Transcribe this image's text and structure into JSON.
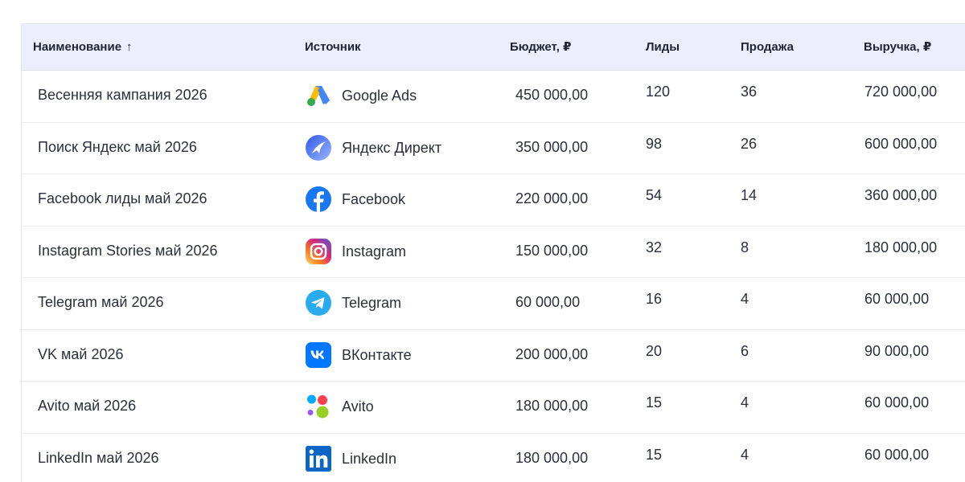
{
  "table": {
    "headers": {
      "name": "Наименование",
      "sort_indicator": "↑",
      "source": "Источник",
      "budget": "Бюджет, ₽",
      "leads": "Лиды",
      "sales": "Продажа",
      "revenue": "Выручка, ₽"
    },
    "rows": [
      {
        "name": "Весенняя кампания 2026",
        "source": "Google Ads",
        "icon": "google-ads-icon",
        "budget": "450 000,00",
        "leads": "120",
        "sales": "36",
        "revenue": "720 000,00"
      },
      {
        "name": "Поиск Яндекс май 2026",
        "source": "Яндекс Директ",
        "icon": "yandex-direct-icon",
        "budget": "350 000,00",
        "leads": "98",
        "sales": "26",
        "revenue": "600 000,00"
      },
      {
        "name": "Facebook лиды май 2026",
        "source": "Facebook",
        "icon": "facebook-icon",
        "budget": "220 000,00",
        "leads": "54",
        "sales": "14",
        "revenue": "360 000,00"
      },
      {
        "name": "Instagram Stories май 2026",
        "source": "Instagram",
        "icon": "instagram-icon",
        "budget": "150 000,00",
        "leads": "32",
        "sales": "8",
        "revenue": "180 000,00"
      },
      {
        "name": "Telegram май 2026",
        "source": "Telegram",
        "icon": "telegram-icon",
        "budget": "60 000,00",
        "leads": "16",
        "sales": "4",
        "revenue": "60 000,00"
      },
      {
        "name": "VK май 2026",
        "source": "ВКонтакте",
        "icon": "vk-icon",
        "budget": "200 000,00",
        "leads": "20",
        "sales": "6",
        "revenue": "90 000,00"
      },
      {
        "name": "Avito май 2026",
        "source": "Avito",
        "icon": "avito-icon",
        "budget": "180 000,00",
        "leads": "15",
        "sales": "4",
        "revenue": "60 000,00"
      },
      {
        "name": "LinkedIn май 2026",
        "source": "LinkedIn",
        "icon": "linkedin-icon",
        "budget": "180 000,00",
        "leads": "15",
        "sales": "4",
        "revenue": "60 000,00"
      }
    ]
  },
  "colors": {
    "header_bg": "#eceefd",
    "row_border": "#e8eaf0",
    "text": "#2a2f3a"
  }
}
